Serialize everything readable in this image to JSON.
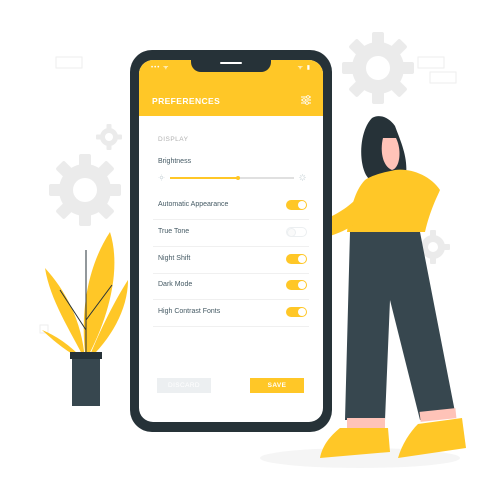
{
  "header": {
    "title": "PREFERENCES",
    "status_left": "••• ᯤ",
    "status_right": "ᯤ ▮"
  },
  "display": {
    "section_label": "DISPLAY",
    "brightness_label": "Brightness",
    "brightness_level": 0.55
  },
  "settings": [
    {
      "label": "Automatic Appearance",
      "on": true
    },
    {
      "label": "True Tone",
      "on": false
    },
    {
      "label": "Night Shift",
      "on": true
    },
    {
      "label": "Dark Mode",
      "on": true
    },
    {
      "label": "High Contrast Fonts",
      "on": true
    }
  ],
  "actions": {
    "discard_label": "DISCARD",
    "save_label": "SAVE"
  },
  "colors": {
    "accent": "#FFC727",
    "dark": "#263238",
    "text": "#455a64",
    "muted": "#eceff1"
  },
  "icons": {
    "header_icon": "sliders-icon",
    "brightness_min": "sun-small-icon",
    "brightness_max": "sun-large-icon"
  }
}
